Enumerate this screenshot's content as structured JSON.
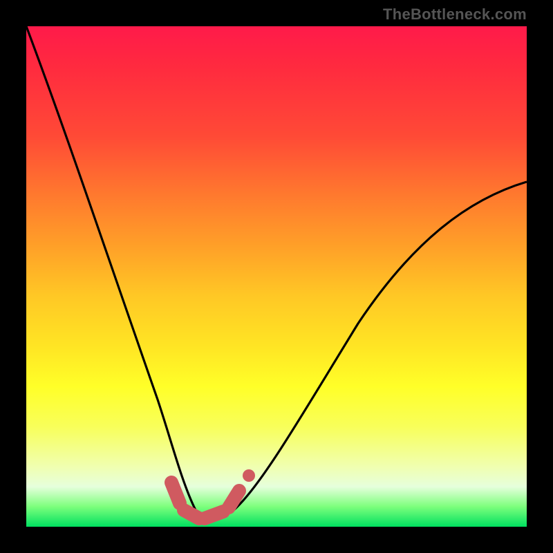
{
  "source_label": "TheBottleneck.com",
  "chart_data": {
    "type": "line",
    "title": "",
    "xlabel": "",
    "ylabel": "",
    "xlim": [
      0,
      1
    ],
    "ylim": [
      0,
      1
    ],
    "series": [
      {
        "name": "bottleneck-curve",
        "x": [
          0.0,
          0.05,
          0.1,
          0.15,
          0.2,
          0.25,
          0.28,
          0.3,
          0.34,
          0.4,
          0.45,
          0.6,
          0.75,
          0.9,
          1.0
        ],
        "values": [
          1.0,
          0.82,
          0.63,
          0.45,
          0.28,
          0.12,
          0.04,
          0.02,
          0.02,
          0.05,
          0.12,
          0.35,
          0.52,
          0.62,
          0.67
        ]
      },
      {
        "name": "trough-marker",
        "x": [
          0.26,
          0.28,
          0.3,
          0.32,
          0.36,
          0.39
        ],
        "values": [
          0.07,
          0.03,
          0.02,
          0.02,
          0.03,
          0.07
        ]
      }
    ],
    "annotations": [
      {
        "type": "dot",
        "x": 0.415,
        "y": 0.075,
        "name": "outlier-marker"
      }
    ],
    "colors": {
      "curve": "#000000",
      "marker": "#d05a60",
      "gradient_top": "#ff1a4a",
      "gradient_bottom": "#00e060"
    }
  }
}
